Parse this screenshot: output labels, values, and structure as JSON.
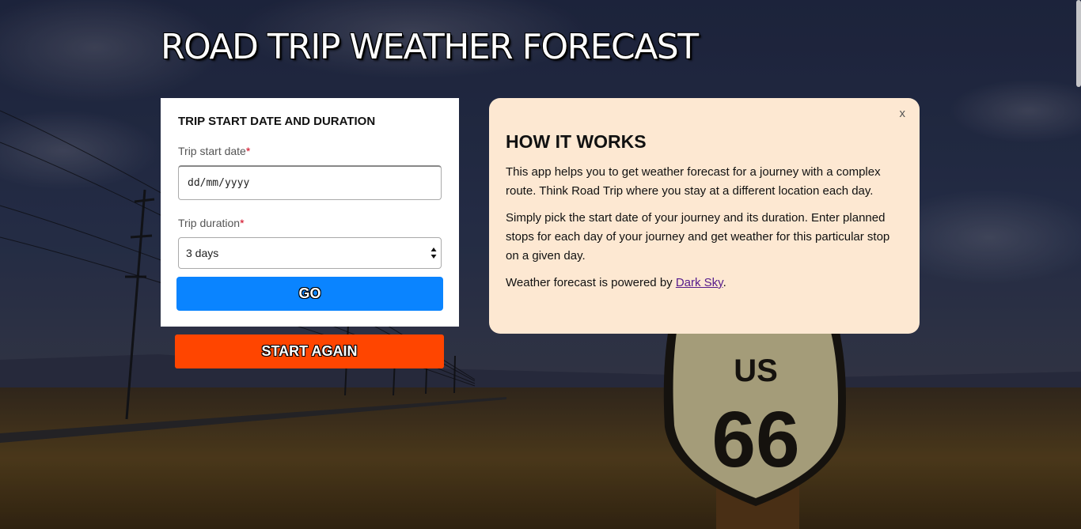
{
  "page": {
    "title": "ROAD TRIP WEATHER FORECAST",
    "background_sign": {
      "line1": "US",
      "line2": "66"
    }
  },
  "form": {
    "heading": "TRIP START DATE AND DURATION",
    "start_date_label": "Trip start date",
    "required_mark": "*",
    "start_date_placeholder": "dd/mm/yyyy",
    "duration_label": "Trip duration",
    "duration_selected": "3 days",
    "go_label": "GO"
  },
  "start_again_label": "START AGAIN",
  "info": {
    "close_label": "x",
    "heading": "HOW IT WORKS",
    "paragraph1": "This app helps you to get weather forecast for a journey with a complex route. Think Road Trip where you stay at a different location each day.",
    "paragraph2": "Simply pick the start date of your journey and its duration. Enter planned stops for each day of your journey and get weather for this particular stop on a given day.",
    "paragraph3_prefix": "Weather forecast is powered by ",
    "paragraph3_link": "Dark Sky",
    "paragraph3_suffix": "."
  },
  "colors": {
    "go_button": "#0a84ff",
    "start_again_button": "#ff4500",
    "info_card": "#fde8d2"
  }
}
